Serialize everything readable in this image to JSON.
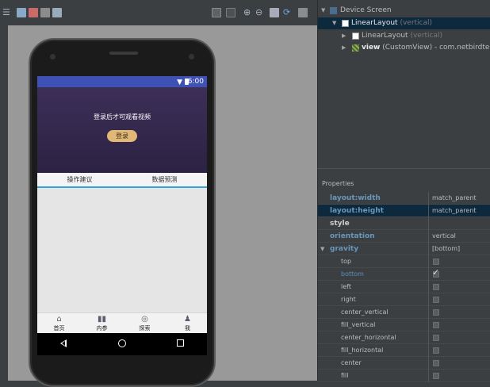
{
  "toolbar": {
    "icons": [
      "menu-icon",
      "dimensions-icon",
      "toggle-icon",
      "theme-icon",
      "zoom-fit-icon",
      "zoom-actual-icon",
      "zoom-in-icon",
      "zoom-out-icon",
      "device-icon",
      "refresh-icon",
      "settings-icon"
    ]
  },
  "phone": {
    "status_time": "6:00",
    "login_hint": "登录后才可观看视频",
    "login_button": "登录",
    "tabs": [
      "操作建议",
      "数据预测"
    ],
    "bottom_nav": [
      {
        "label": "首页",
        "icon": "home-icon"
      },
      {
        "label": "内参",
        "icon": "chart-icon"
      },
      {
        "label": "探索",
        "icon": "compass-icon"
      },
      {
        "label": "我",
        "icon": "shirt-icon"
      }
    ]
  },
  "tree": {
    "root": "Device Screen",
    "items": [
      {
        "name": "LinearLayout",
        "detail": "(vertical)",
        "selected": true
      },
      {
        "name": "LinearLayout",
        "detail": "(vertical)",
        "selected": false
      },
      {
        "name": "view",
        "detail": "(CustomView) - com.netbirdtech.app",
        "selected": false
      }
    ]
  },
  "properties": {
    "header": "Properties",
    "rows": [
      {
        "name": "layout:width",
        "value": "match_parent"
      },
      {
        "name": "layout:height",
        "value": "match_parent"
      },
      {
        "name": "style",
        "value": ""
      },
      {
        "name": "orientation",
        "value": "vertical"
      },
      {
        "name": "gravity",
        "value": "[bottom]"
      }
    ],
    "gravity_flags": [
      {
        "name": "top",
        "checked": false
      },
      {
        "name": "bottom",
        "checked": true
      },
      {
        "name": "left",
        "checked": false
      },
      {
        "name": "right",
        "checked": false
      },
      {
        "name": "center_vertical",
        "checked": false
      },
      {
        "name": "fill_vertical",
        "checked": false
      },
      {
        "name": "center_horizontal",
        "checked": false
      },
      {
        "name": "fill_horizontal",
        "checked": false
      },
      {
        "name": "center",
        "checked": false
      },
      {
        "name": "fill",
        "checked": false
      }
    ]
  }
}
